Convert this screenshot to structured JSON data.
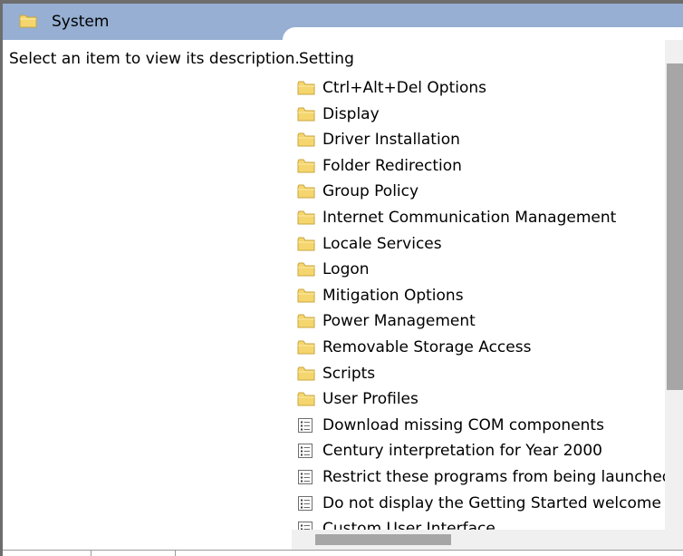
{
  "header": {
    "title": "System",
    "icon": "folder-icon"
  },
  "description_pane": {
    "text": "Select an item to view its description."
  },
  "list": {
    "column_header": "Setting",
    "items": [
      {
        "label": "Ctrl+Alt+Del Options",
        "icon": "folder-icon"
      },
      {
        "label": "Display",
        "icon": "folder-icon"
      },
      {
        "label": "Driver Installation",
        "icon": "folder-icon"
      },
      {
        "label": "Folder Redirection",
        "icon": "folder-icon"
      },
      {
        "label": "Group Policy",
        "icon": "folder-icon"
      },
      {
        "label": "Internet Communication Management",
        "icon": "folder-icon"
      },
      {
        "label": "Locale Services",
        "icon": "folder-icon"
      },
      {
        "label": "Logon",
        "icon": "folder-icon"
      },
      {
        "label": "Mitigation Options",
        "icon": "folder-icon"
      },
      {
        "label": "Power Management",
        "icon": "folder-icon"
      },
      {
        "label": "Removable Storage Access",
        "icon": "folder-icon"
      },
      {
        "label": "Scripts",
        "icon": "folder-icon"
      },
      {
        "label": "User Profiles",
        "icon": "folder-icon"
      },
      {
        "label": "Download missing COM components",
        "icon": "policy-setting-icon"
      },
      {
        "label": "Century interpretation for Year 2000",
        "icon": "policy-setting-icon"
      },
      {
        "label": "Restrict these programs from being launched from Help",
        "icon": "policy-setting-icon"
      },
      {
        "label": "Do not display the Getting Started welcome screen at logon",
        "icon": "policy-setting-icon"
      },
      {
        "label": "Custom User Interface",
        "icon": "policy-setting-icon"
      }
    ]
  },
  "colors": {
    "header_bg": "#96afd2",
    "folder_yellow": "#f5d66e",
    "scroll_thumb": "#a6a6a6"
  }
}
